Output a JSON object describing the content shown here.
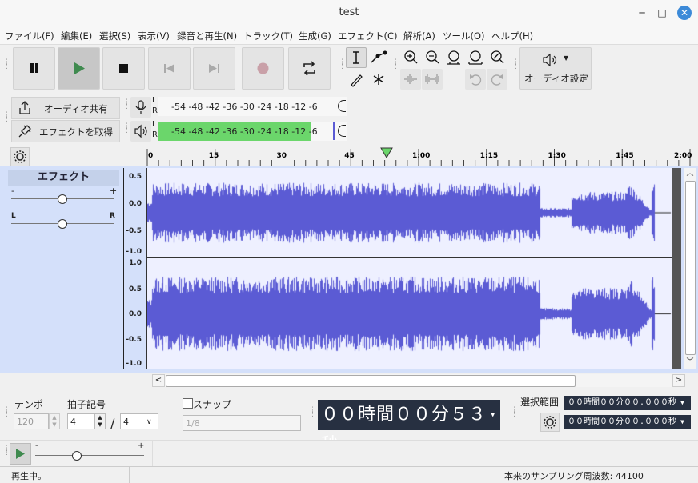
{
  "window": {
    "title": "test",
    "minimize": "─",
    "maximize": "□",
    "close": "✕"
  },
  "menu": [
    {
      "label": "ファイル(F)"
    },
    {
      "label": "編集(E)"
    },
    {
      "label": "選択(S)"
    },
    {
      "label": "表示(V)"
    },
    {
      "label": "録音と再生(N)"
    },
    {
      "label": "トラック(T)"
    },
    {
      "label": "生成(G)"
    },
    {
      "label": "エフェクト(C)"
    },
    {
      "label": "解析(A)"
    },
    {
      "label": "ツール(O)"
    },
    {
      "label": "ヘルプ(H)"
    }
  ],
  "toolbar": {
    "audio_setup_label": "オーディオ設定",
    "share_audio_label": "オーディオ共有",
    "get_effects_label": "エフェクトを取得"
  },
  "meters": {
    "record": {
      "l": "L",
      "r": "R",
      "scale": "-54  -48  -42  -36  -30  -24  -18  -12   -6",
      "level": 0
    },
    "playback": {
      "l": "L",
      "r": "R",
      "scale": "-54  -48  -42  -36  -30  -24  -18  -12   -6",
      "level": 0.81
    }
  },
  "timeline": {
    "ticks": [
      "0",
      "15",
      "30",
      "45",
      "1:00",
      "1:15",
      "1:30",
      "1:45",
      "2:00"
    ],
    "playhead_seconds": 53,
    "duration_seconds": 120
  },
  "track": {
    "effects_label": "エフェクト",
    "gain_minus": "-",
    "gain_plus": "+",
    "pan_left": "L",
    "pan_right": "R",
    "gain_value": 0.5,
    "pan_value": 0.5,
    "channel1_ticks": [
      "0.5",
      "0.0",
      "-0.5",
      "-1.0"
    ],
    "channel2_ticks": [
      "1.0",
      "0.5",
      "0.0",
      "-0.5",
      "-1.0"
    ],
    "wave_color": "#5b5bd4"
  },
  "bottom": {
    "tempo_label": "テンポ",
    "tempo_value": "120",
    "time_sig_label": "拍子記号",
    "time_sig_num": "4",
    "time_sig_slash": "/",
    "time_sig_den": "4",
    "snap_label": "スナップ",
    "snap_value": "1/8",
    "time_display": "００時間００分５３秒",
    "selection_label": "選択範囲",
    "selection_start": "００時間００分００.０００秒",
    "selection_end": "００時間００分００.０００秒",
    "speed_minus": "-",
    "speed_plus": "+",
    "speed_value": 0.38
  },
  "status": {
    "left": "再生中。",
    "right": "本来のサンプリング周波数: 44100"
  },
  "colors": {
    "accent": "#4a8a55",
    "waveform": "#5b5bd4",
    "meter_green": "#6bd66b",
    "time_display_bg": "#273041"
  }
}
